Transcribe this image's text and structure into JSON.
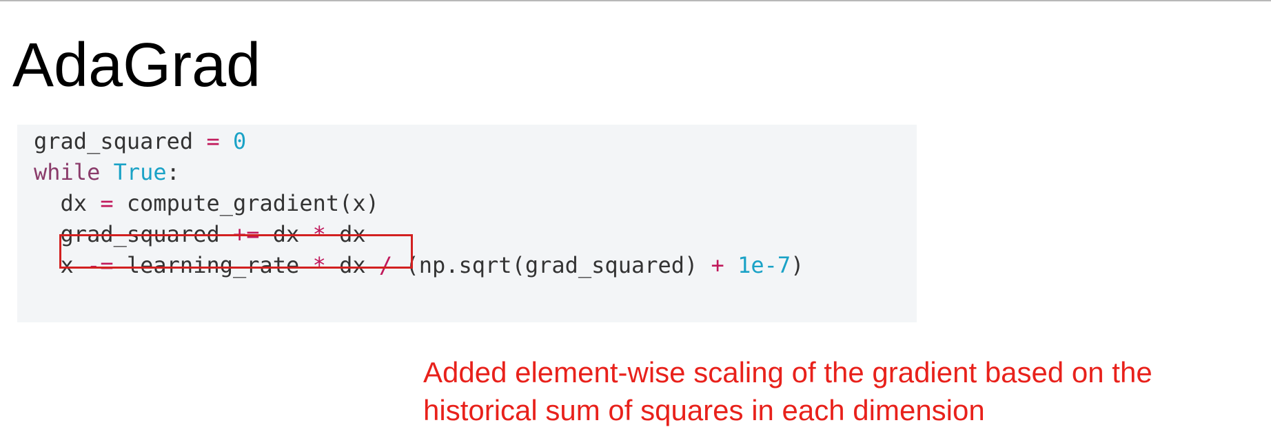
{
  "slide": {
    "title": "AdaGrad"
  },
  "code": {
    "lines": [
      {
        "tokens": [
          {
            "text": "grad_squared ",
            "kind": "plain"
          },
          {
            "text": "=",
            "kind": "op"
          },
          {
            "text": " ",
            "kind": "plain"
          },
          {
            "text": "0",
            "kind": "num"
          }
        ]
      },
      {
        "tokens": [
          {
            "text": "while",
            "kind": "kw"
          },
          {
            "text": " ",
            "kind": "plain"
          },
          {
            "text": "True",
            "kind": "const"
          },
          {
            "text": ":",
            "kind": "plain"
          }
        ]
      },
      {
        "tokens": [
          {
            "text": "  dx ",
            "kind": "plain"
          },
          {
            "text": "=",
            "kind": "op"
          },
          {
            "text": " compute_gradient(x)",
            "kind": "plain"
          }
        ]
      },
      {
        "tokens": [
          {
            "text": "  grad_squared ",
            "kind": "plain"
          },
          {
            "text": "+=",
            "kind": "op"
          },
          {
            "text": " dx ",
            "kind": "plain"
          },
          {
            "text": "*",
            "kind": "op"
          },
          {
            "text": " dx",
            "kind": "plain"
          }
        ]
      },
      {
        "tokens": [
          {
            "text": "  x ",
            "kind": "plain"
          },
          {
            "text": "-=",
            "kind": "op"
          },
          {
            "text": " learning_rate ",
            "kind": "plain"
          },
          {
            "text": "*",
            "kind": "op"
          },
          {
            "text": " dx ",
            "kind": "plain"
          },
          {
            "text": "/",
            "kind": "op"
          },
          {
            "text": " (np.sqrt(grad_squared) ",
            "kind": "plain"
          },
          {
            "text": "+",
            "kind": "op"
          },
          {
            "text": " ",
            "kind": "plain"
          },
          {
            "text": "1e-7",
            "kind": "num"
          },
          {
            "text": ")",
            "kind": "plain"
          }
        ]
      }
    ]
  },
  "annotation": {
    "line1": "Added element-wise scaling of the gradient based on the",
    "line2": "historical sum of squares in each dimension"
  },
  "colors": {
    "title": "#000000",
    "code_background": "#f3f5f7",
    "code_text": "#333333",
    "keyword": "#8a3b6a",
    "operator": "#c0185a",
    "number": "#1aa2c6",
    "highlight_box": "#d22020",
    "annotation": "#e8211b"
  }
}
